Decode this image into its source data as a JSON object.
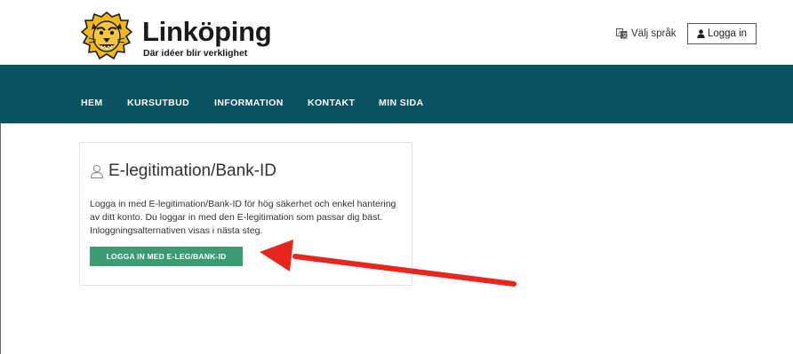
{
  "header": {
    "brand_name": "Linköping",
    "brand_slogan": "Där idéer blir verklighet",
    "language_label": "Välj språk",
    "login_label": "Logga in"
  },
  "nav": {
    "items": [
      {
        "label": "HEM"
      },
      {
        "label": "KURSUTBUD"
      },
      {
        "label": "INFORMATION"
      },
      {
        "label": "KONTAKT"
      },
      {
        "label": "MIN SIDA"
      }
    ]
  },
  "card": {
    "title": "E-legitimation/Bank-ID",
    "text": "Logga in med E-legitimation/Bank-ID för hög säkerhet och enkel hantering av ditt konto. Du loggar in med den E-legitimation som passar dig bäst. Inloggningsalternativen visas i nästa steg.",
    "button_label": "LOGGA IN MED E-LEG/BANK-ID"
  },
  "icons": {
    "logo": "lion-logo-icon",
    "language": "translate-icon",
    "login": "user-icon",
    "card": "user-outline-icon",
    "annotation": "red-arrow-icon"
  },
  "colors": {
    "nav_background": "#0a5462",
    "button_background": "#3b9b73",
    "annotation_arrow": "#e8261e",
    "logo_yellow": "#f2b817"
  }
}
